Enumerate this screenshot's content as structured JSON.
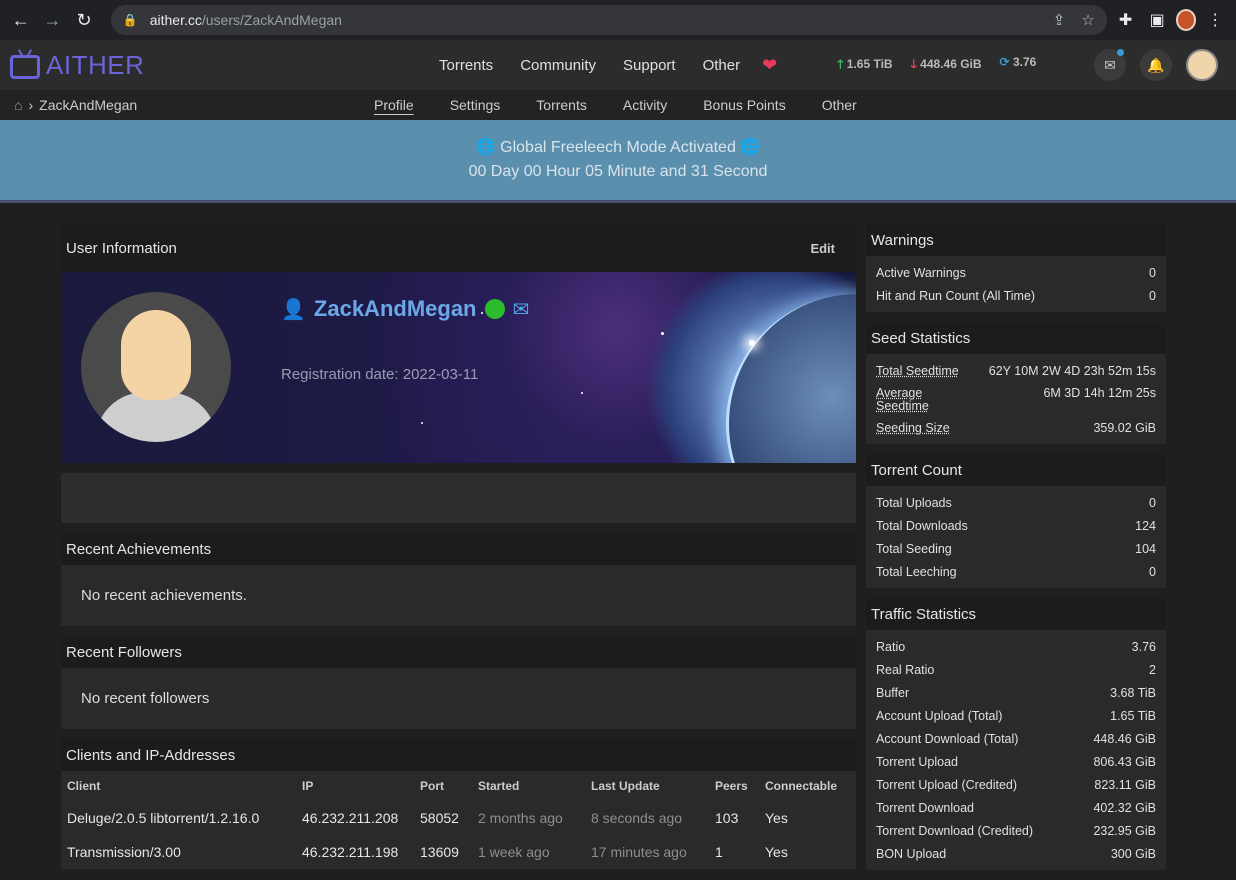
{
  "browser": {
    "url_host": "aither.cc",
    "url_path": "/users/ZackAndMegan"
  },
  "site": {
    "name": "AITHER",
    "menu": [
      "Torrents",
      "Community",
      "Support",
      "Other"
    ],
    "stats": {
      "upload": "1.65 TiB",
      "download": "448.46 GiB",
      "ratio": "3.76"
    }
  },
  "subnav": {
    "breadcrumb": "ZackAndMegan",
    "tabs": [
      "Profile",
      "Settings",
      "Torrents",
      "Activity",
      "Bonus Points",
      "Other"
    ]
  },
  "banner": {
    "title": "Global Freeleech Mode Activated",
    "countdown": "00 Day 00 Hour 05 Minute and 31 Second"
  },
  "user_info": {
    "title": "User Information",
    "edit_label": "Edit",
    "username": "ZackAndMegan",
    "registration": "Registration date: 2022-03-11"
  },
  "achievements": {
    "title": "Recent Achievements",
    "empty": "No recent achievements."
  },
  "followers": {
    "title": "Recent Followers",
    "empty": "No recent followers"
  },
  "clients": {
    "title": "Clients and IP-Addresses",
    "headers": [
      "Client",
      "IP",
      "Port",
      "Started",
      "Last Update",
      "Peers",
      "Connectable"
    ],
    "rows": [
      [
        "Deluge/2.0.5 libtorrent/1.2.16.0",
        "46.232.211.208",
        "58052",
        "2 months ago",
        "8 seconds ago",
        "103",
        "Yes"
      ],
      [
        "Transmission/3.00",
        "46.232.211.198",
        "13609",
        "1 week ago",
        "17 minutes ago",
        "1",
        "Yes"
      ]
    ]
  },
  "warnings": {
    "title": "Warnings",
    "rows": [
      [
        "Active Warnings",
        "0"
      ],
      [
        "Hit and Run Count (All Time)",
        "0"
      ]
    ]
  },
  "seed_stats": {
    "title": "Seed Statistics",
    "rows": [
      [
        "Total Seedtime",
        "62Y 10M 2W 4D 23h 52m 15s"
      ],
      [
        "Average Seedtime",
        "6M 3D 14h 12m 25s"
      ],
      [
        "Seeding Size",
        "359.02 GiB"
      ]
    ]
  },
  "torrent_count": {
    "title": "Torrent Count",
    "rows": [
      [
        "Total Uploads",
        "0"
      ],
      [
        "Total Downloads",
        "124"
      ],
      [
        "Total Seeding",
        "104"
      ],
      [
        "Total Leeching",
        "0"
      ]
    ]
  },
  "traffic": {
    "title": "Traffic Statistics",
    "rows": [
      [
        "Ratio",
        "3.76"
      ],
      [
        "Real Ratio",
        "2"
      ],
      [
        "Buffer",
        "3.68 TiB"
      ],
      [
        "Account Upload (Total)",
        "1.65 TiB"
      ],
      [
        "Account Download (Total)",
        "448.46 GiB"
      ],
      [
        "Torrent Upload",
        "806.43 GiB"
      ],
      [
        "Torrent Upload (Credited)",
        "823.11 GiB"
      ],
      [
        "Torrent Download",
        "402.32 GiB"
      ],
      [
        "Torrent Download (Credited)",
        "232.95 GiB"
      ],
      [
        "BON Upload",
        "300 GiB"
      ]
    ]
  }
}
